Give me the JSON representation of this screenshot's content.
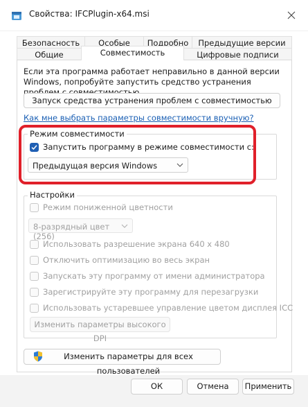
{
  "window": {
    "title": "Свойства: IFCPlugin-x64.msi"
  },
  "tabs": {
    "row1": [
      "Безопасность",
      "Особые",
      "Подробно",
      "Предыдущие версии"
    ],
    "row2": [
      "Общие",
      "Совместимость",
      "Цифровые подписи"
    ],
    "active": "Совместимость"
  },
  "intro": {
    "text": "Если эта программа работает неправильно в данной версии Windows, попробуйте запустить средство устранения проблем с совместимостью."
  },
  "troubleshoot_button": "Запуск средства устранения проблем с совместимостью",
  "help_link": "Как мне выбрать параметры совместимости вручную?",
  "compat_mode": {
    "group_title": "Режим совместимости",
    "checkbox_label": "Запустить программу в режиме совместимости с:",
    "checked": true,
    "selected_os": "Предыдущая версия Windows"
  },
  "settings": {
    "group_title": "Настройки",
    "reduced_color": "Режим пониженной цветности",
    "color_select": "8-разрядный цвет (256)",
    "options": [
      "Использовать разрешение экрана 640 x 480",
      "Отключить оптимизацию во весь экран",
      "Запускать эту программу от имени администратора",
      "Зарегистрируйте эту программу для перезагрузки",
      "Использовать устаревшее управление цветом дисплея ICC"
    ],
    "high_dpi_button": "Изменить параметры высокого DPI"
  },
  "all_users_button": "Изменить параметры для всех пользователей",
  "footer": {
    "ok": "ОК",
    "cancel": "Отмена",
    "apply": "Применить"
  },
  "colors": {
    "accent": "#1f5fb4",
    "highlight": "#e0202a",
    "link": "#1a5fb4"
  }
}
